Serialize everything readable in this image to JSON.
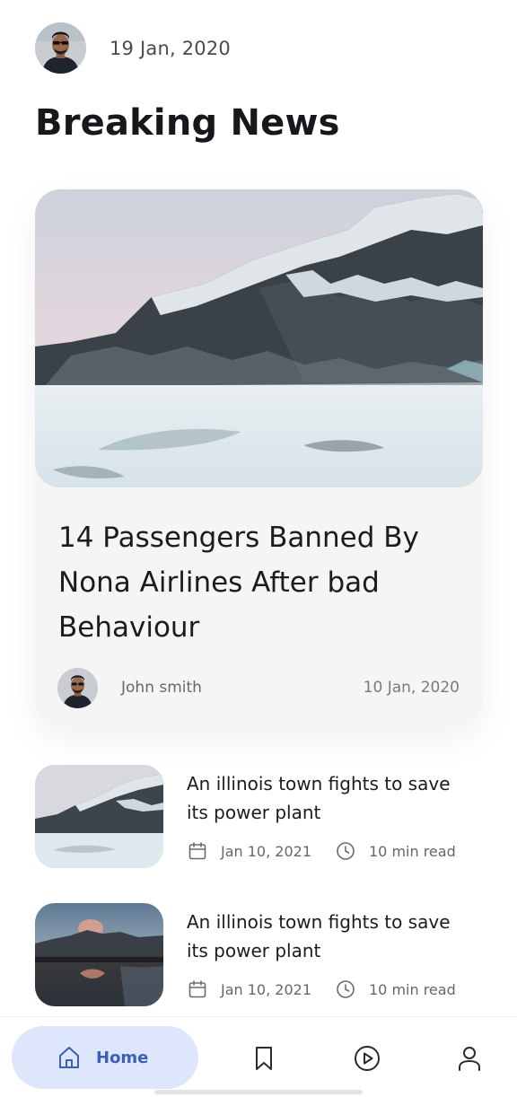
{
  "header": {
    "date": "19 Jan, 2020",
    "avatar_icon": "user-avatar"
  },
  "page_title": "Breaking News",
  "featured": {
    "image_icon": "snowy-mountain-image",
    "title": "14 Passengers Banned By Nona Airlines After bad Behaviour",
    "author": "John smith",
    "date": "10 Jan, 2020"
  },
  "news_list": [
    {
      "title": "An illinois town fights to save its power plant",
      "date": "Jan 10, 2021",
      "read_time": "10 min read",
      "image_icon": "snowy-mountain-image"
    },
    {
      "title": "An illinois town fights to save its power plant",
      "date": "Jan 10, 2021",
      "read_time": "10 min read",
      "image_icon": "mountain-lake-sunset-image"
    }
  ],
  "bottom_nav": {
    "home_label": "Home",
    "items": [
      "home-icon",
      "bookmark-icon",
      "play-icon",
      "profile-icon"
    ],
    "active_color": "#3d5fb8",
    "active_bg": "#dde6fb"
  }
}
